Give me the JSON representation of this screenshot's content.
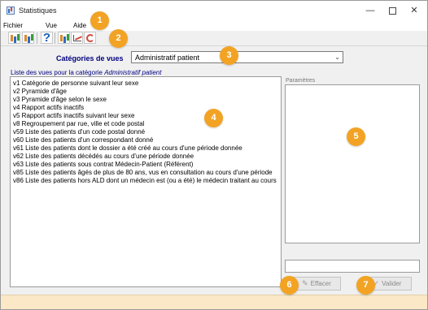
{
  "window": {
    "title": "Statistiques"
  },
  "menu": {
    "items": [
      "Fichier",
      "Vue",
      "Aide"
    ]
  },
  "categories": {
    "label": "Catégories de vues",
    "selected": "Administratif patient"
  },
  "list": {
    "caption_prefix": "Liste des vues pour la catégorie",
    "caption_category": "Administratif patient",
    "items": [
      "v1 Catégorie de personne suivant leur sexe",
      "v2 Pyramide d'âge",
      "v3 Pyramide d'âge selon le sexe",
      "v4 Rapport actifs inactifs",
      "v5 Rapport actifs inactifs suivant leur sexe",
      "v8 Regroupement par rue, ville et code postal",
      "v59 Liste des patients d'un code postal donné",
      "v60 Liste des patients d'un correspondant donné",
      "v61 Liste des patients dont le dossier a été créé au cours d'une période donnée",
      "v62 Liste des patients décédés au cours d'une période donnée",
      "v63 Liste des patients sous contrat Médecin-Patient (Référent)",
      "v85 Liste des patients âgés de plus de 80 ans, vus en consultation au cours d'une période",
      "v86 Liste des patients hors ALD dont un médecin est (ou a été) le médecin traitant au cours"
    ]
  },
  "params": {
    "label": "Paramètres"
  },
  "buttons": {
    "erase": "Effacer",
    "validate": "Valider"
  },
  "badges": [
    "1",
    "2",
    "3",
    "4",
    "5",
    "6",
    "7"
  ],
  "colors": {
    "accent_text": "#000080",
    "badge": "#f2a324",
    "status_bar": "#fbe8c6"
  }
}
